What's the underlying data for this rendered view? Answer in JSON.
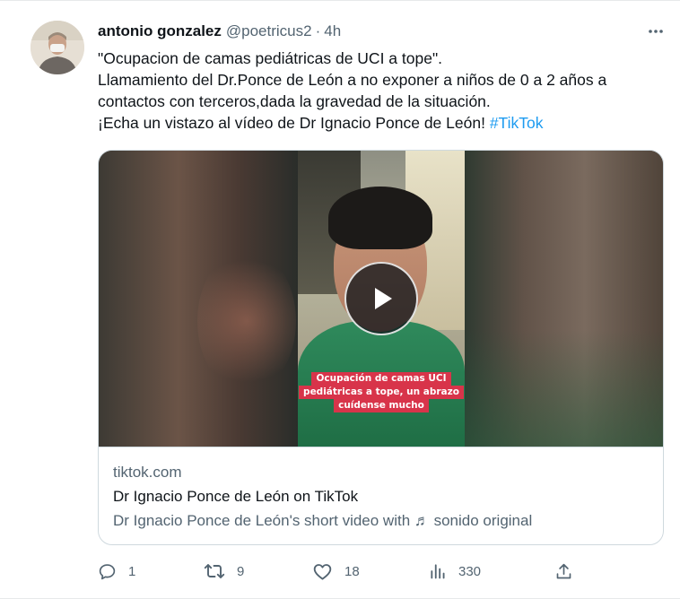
{
  "author": {
    "name": "antonio gonzalez",
    "handle": "@poetricus2",
    "separator": "·",
    "time": "4h"
  },
  "tweet": {
    "line1": "\"Ocupacion de camas pediátricas de UCI a tope\".",
    "line2": "Llamamiento del Dr.Ponce de León a no exponer a niños de 0 a 2 años a",
    "line3": "contactos con terceros,dada la gravedad de la situación.",
    "line4_text": "¡Echa un vistazo al vídeo de Dr Ignacio Ponce de León! ",
    "hashtag": "#TikTok"
  },
  "video_overlay": {
    "line1": "Ocupación de camas UCI",
    "line2": "pediátricas a tope, un abrazo",
    "line3": "cuídense mucho"
  },
  "card": {
    "domain": "tiktok.com",
    "title": "Dr Ignacio Ponce de León on TikTok",
    "description": "Dr Ignacio Ponce de León's short video with ♬ sonido original"
  },
  "actions": {
    "replies": "1",
    "retweets": "9",
    "likes": "18",
    "views": "330"
  },
  "icons": {
    "more": "more-horizontal-icon",
    "reply": "reply-icon",
    "retweet": "retweet-icon",
    "like": "heart-icon",
    "views": "views-icon",
    "share": "share-icon",
    "play": "play-icon"
  },
  "colors": {
    "text": "#0f1419",
    "secondary": "#536471",
    "link": "#1d9bf0",
    "overlay_label": "#d8344a"
  }
}
